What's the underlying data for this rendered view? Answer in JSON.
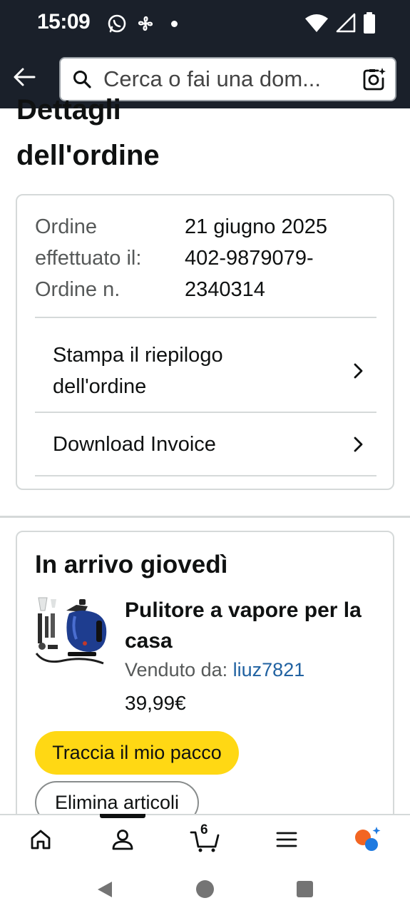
{
  "status_bar": {
    "time": "15:09"
  },
  "search": {
    "placeholder": "Cerca o fai una dom..."
  },
  "page": {
    "title_cut": "Dettagli",
    "title": "dell'ordine"
  },
  "order": {
    "date_label": "Ordine",
    "date_label_2": "effettuato il:",
    "date_value": "21 giugno 2025",
    "number_label": "Ordine n.",
    "number_value_1": "402-9879079-",
    "number_value_2": "2340314",
    "print_summary_line1": "Stampa il riepilogo",
    "print_summary_line2": "dell'ordine",
    "download_invoice": "Download Invoice"
  },
  "shipment": {
    "arrival": "In arrivo giovedì",
    "product_title": "Pulitore a vapore per la casa",
    "sold_by_label": "Venduto da:",
    "seller": "liuz7821",
    "price": "39,99€",
    "track_button": "Traccia il mio pacco",
    "delete_button": "Elimina articoli"
  },
  "bottom_nav": {
    "cart_count": "6"
  },
  "colors": {
    "header_bg": "#1a202a",
    "track_button": "#ffd814",
    "link": "#2162a1"
  }
}
